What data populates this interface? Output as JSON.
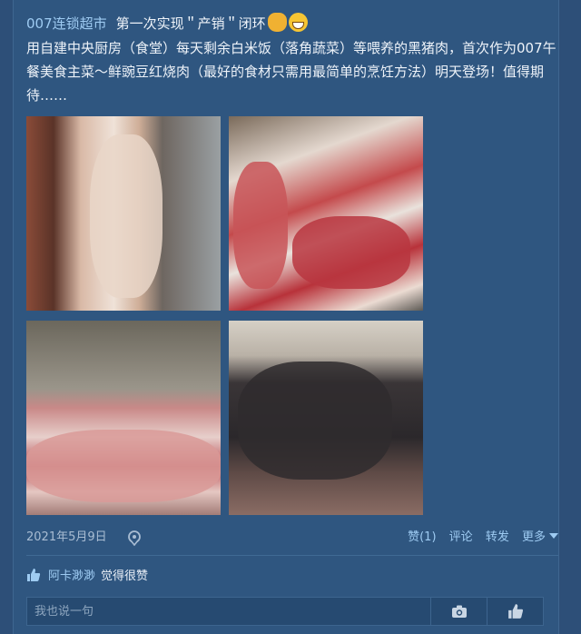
{
  "post": {
    "author": "007连锁超市",
    "headline": "第一次实现＂产销＂闭环",
    "body": "用自建中央厨房（食堂）每天剩余白米饭（落角蔬菜）等喂养的黑猪肉，首次作为007午餐美食主菜～鲜豌豆红烧肉（最好的食材只需用最简单的烹饪方法）明天登场！值得期待……",
    "emojis": [
      "fist-emoji",
      "grin-emoji"
    ]
  },
  "footer": {
    "date": "2021年5月9日",
    "like_label": "赞(1)",
    "comment_label": "评论",
    "share_label": "转发",
    "more_label": "更多"
  },
  "likes": {
    "user": "阿卡渺渺",
    "suffix": "觉得很赞"
  },
  "comment": {
    "placeholder": "我也说一句"
  },
  "icons": {
    "location": "location-pin-icon",
    "camera": "camera-icon",
    "thumb": "thumbs-up-icon"
  },
  "colors": {
    "background": "#2d4f78",
    "link": "#9ecbf2"
  }
}
